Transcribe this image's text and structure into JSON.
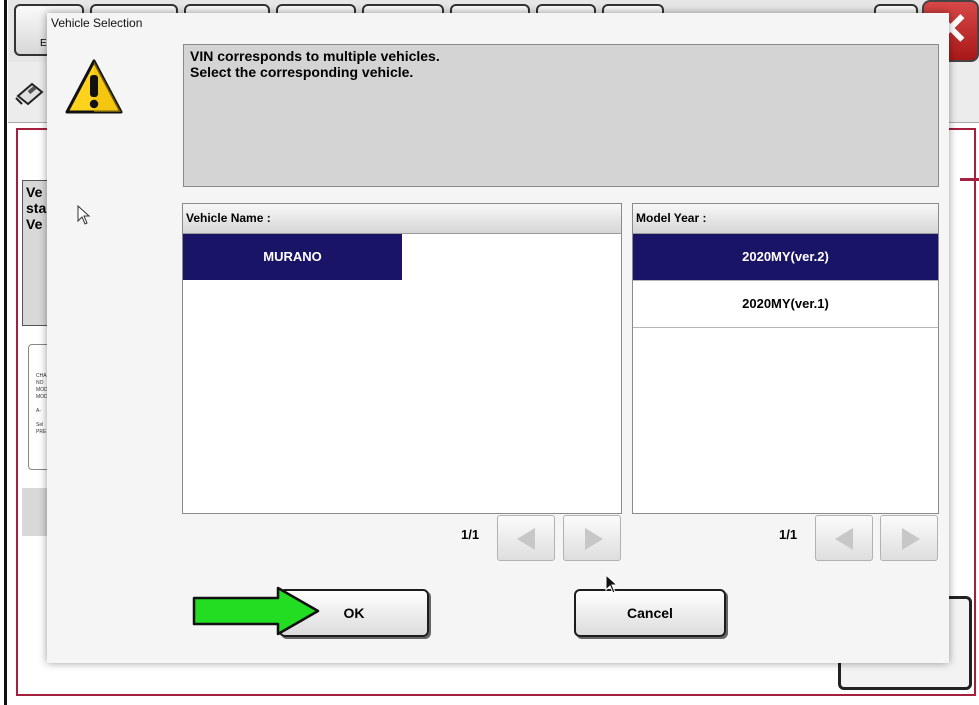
{
  "background_app": {
    "tab_label": "E",
    "side_text": [
      "Ve",
      "sta",
      "Ve"
    ],
    "side_card_lines": [
      "CHA",
      "NO",
      "MOD",
      "MOD",
      "",
      "A-",
      "",
      "Sel",
      "PRE"
    ]
  },
  "dialog": {
    "title": "Vehicle Selection",
    "message_line1": "VIN corresponds to multiple vehicles.",
    "message_line2": "Select the corresponding vehicle."
  },
  "vehicle_name": {
    "header": "Vehicle Name :",
    "items": [
      "MURANO"
    ],
    "selected_index": 0,
    "page": "1/1"
  },
  "model_year": {
    "header": "Model Year :",
    "items": [
      "2020MY(ver.2)",
      "2020MY(ver.1)"
    ],
    "selected_index": 0,
    "page": "1/1"
  },
  "buttons": {
    "ok_label": "OK",
    "cancel_label": "Cancel"
  },
  "colors": {
    "selection": "#1a1466",
    "panel_border": "#a4203e",
    "arrow": "#22dd22"
  }
}
